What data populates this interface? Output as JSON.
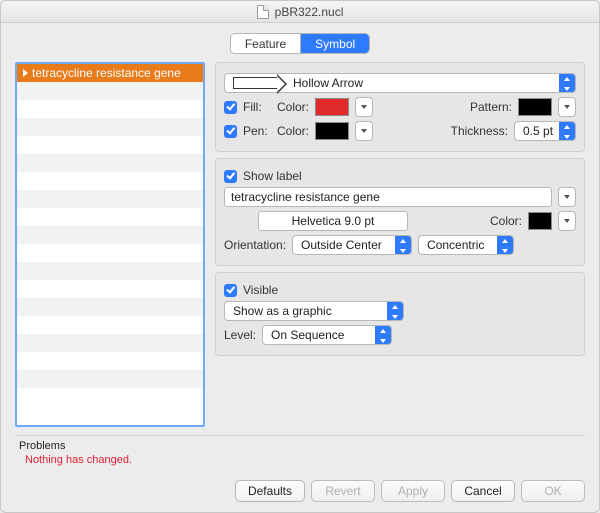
{
  "window": {
    "title": "pBR322.nucl"
  },
  "tabs": {
    "feature": "Feature",
    "symbol": "Symbol",
    "active": "symbol"
  },
  "feature_list": {
    "selected_index": 0,
    "items": [
      "tetracycline resistance gene"
    ]
  },
  "shape": {
    "name": "Hollow Arrow"
  },
  "fill": {
    "label": "Fill:",
    "checked": true,
    "color_label": "Color:",
    "color": "#e12b2b",
    "pattern_label": "Pattern:",
    "pattern": "#000000"
  },
  "pen": {
    "label": "Pen:",
    "checked": true,
    "color_label": "Color:",
    "color": "#000000",
    "thickness_label": "Thickness:",
    "thickness": "0.5 pt"
  },
  "label_section": {
    "show_label": "Show label",
    "show_label_checked": true,
    "text": "tetracycline resistance gene",
    "font": "Helvetica 9.0 pt",
    "color_label": "Color:",
    "color": "#000000",
    "orientation_label": "Orientation:",
    "orientation_value": "Outside Center",
    "curve_value": "Concentric"
  },
  "visibility": {
    "visible_label": "Visible",
    "visible_checked": true,
    "showas": "Show as a graphic",
    "level_label": "Level:",
    "level_value": "On Sequence"
  },
  "problems": {
    "header": "Problems",
    "message": "Nothing has changed."
  },
  "buttons": {
    "defaults": "Defaults",
    "revert": "Revert",
    "apply": "Apply",
    "cancel": "Cancel",
    "ok": "OK"
  }
}
